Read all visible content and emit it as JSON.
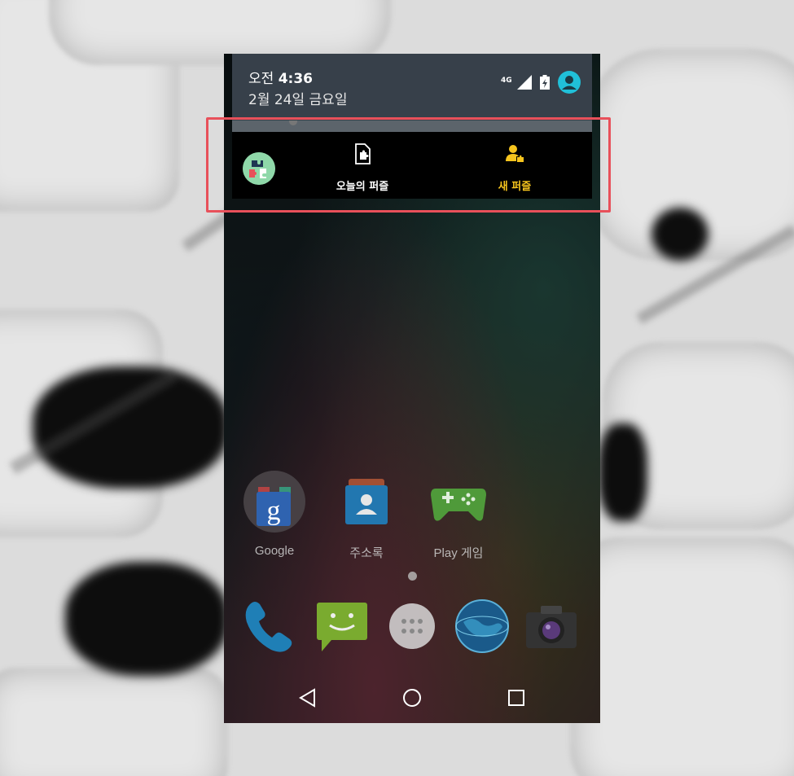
{
  "status_bar": {
    "time_prefix": "오전",
    "time": "4:36",
    "date": "2월 24일 금요일",
    "network_label": "4G",
    "icons": [
      "signal-icon",
      "battery-icon",
      "avatar-icon"
    ]
  },
  "notification": {
    "app_icon": "puzzle-app-icon",
    "actions": [
      {
        "label": "오늘의 퍼즐",
        "icon": "puzzle-document-icon",
        "color": "#ffffff"
      },
      {
        "label": "새 퍼즐",
        "icon": "new-puzzle-person-icon",
        "color": "#f7c51e"
      }
    ],
    "highlight_color": "#e8505a"
  },
  "home": {
    "apps": [
      {
        "label": "Google",
        "icon": "google-folder-icon"
      },
      {
        "label": "주소록",
        "icon": "contacts-icon"
      },
      {
        "label": "Play 게임",
        "icon": "play-games-icon"
      }
    ],
    "dock": [
      "phone-icon",
      "messaging-icon",
      "app-drawer-icon",
      "browser-globe-icon",
      "camera-icon"
    ]
  },
  "navbar": {
    "buttons": [
      "back-button",
      "home-button",
      "recents-button"
    ]
  }
}
